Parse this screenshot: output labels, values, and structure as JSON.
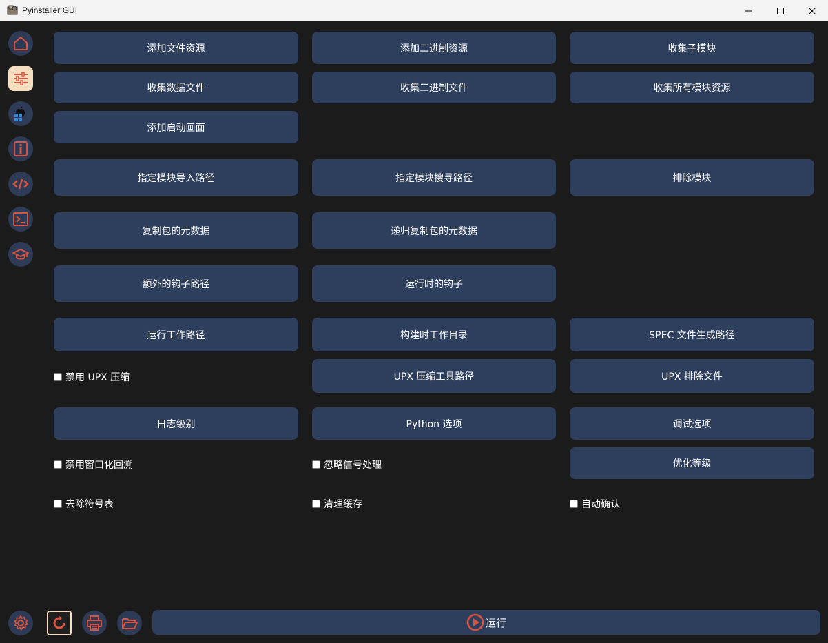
{
  "window": {
    "title": "Pyinstaller GUI"
  },
  "sidebar": {
    "items": [
      {
        "icon": "home-icon"
      },
      {
        "icon": "sliders-icon",
        "active": true
      },
      {
        "icon": "platform-icon"
      },
      {
        "icon": "info-icon"
      },
      {
        "icon": "code-icon"
      },
      {
        "icon": "terminal-icon"
      },
      {
        "icon": "graduation-cap-icon"
      }
    ]
  },
  "buttons": {
    "add_file_resource": "添加文件资源",
    "add_binary_resource": "添加二进制资源",
    "collect_submodules": "收集子模块",
    "collect_data_files": "收集数据文件",
    "collect_binary_files": "收集二进制文件",
    "collect_all_module_resources": "收集所有模块资源",
    "add_splash": "添加启动画面",
    "module_import_path": "指定模块导入路径",
    "module_search_path": "指定模块搜寻路径",
    "exclude_module": "排除模块",
    "copy_metadata": "复制包的元数据",
    "recursive_copy_metadata": "递归复制包的元数据",
    "extra_hooks_path": "额外的钩子路径",
    "runtime_hooks": "运行时的钩子",
    "run_work_path": "运行工作路径",
    "build_work_dir": "构建时工作目录",
    "spec_output_path": "SPEC 文件生成路径",
    "upx_tool_path": "UPX 压缩工具路径",
    "upx_exclude_file": "UPX 排除文件",
    "log_level": "日志级别",
    "python_options": "Python 选项",
    "debug_options": "调试选项",
    "optimize_level": "优化等级"
  },
  "checkboxes": {
    "disable_upx": {
      "label": "禁用 UPX 压缩",
      "checked": false
    },
    "disable_windowed_traceback": {
      "label": "禁用窗口化回溯",
      "checked": false
    },
    "ignore_signals": {
      "label": "忽略信号处理",
      "checked": false
    },
    "strip_symbols": {
      "label": "去除符号表",
      "checked": false
    },
    "clean_cache": {
      "label": "清理缓存",
      "checked": false
    },
    "auto_confirm": {
      "label": "自动确认",
      "checked": false
    }
  },
  "bottom_bar": {
    "icons": [
      "gear-icon",
      "refresh-icon",
      "printer-icon",
      "folder-icon"
    ],
    "run_label": "运行"
  },
  "colors": {
    "accent": "#d9533f",
    "button_bg": "#2e3f5e",
    "background": "#1b1b1b",
    "active_bg": "#f5dfc0"
  }
}
